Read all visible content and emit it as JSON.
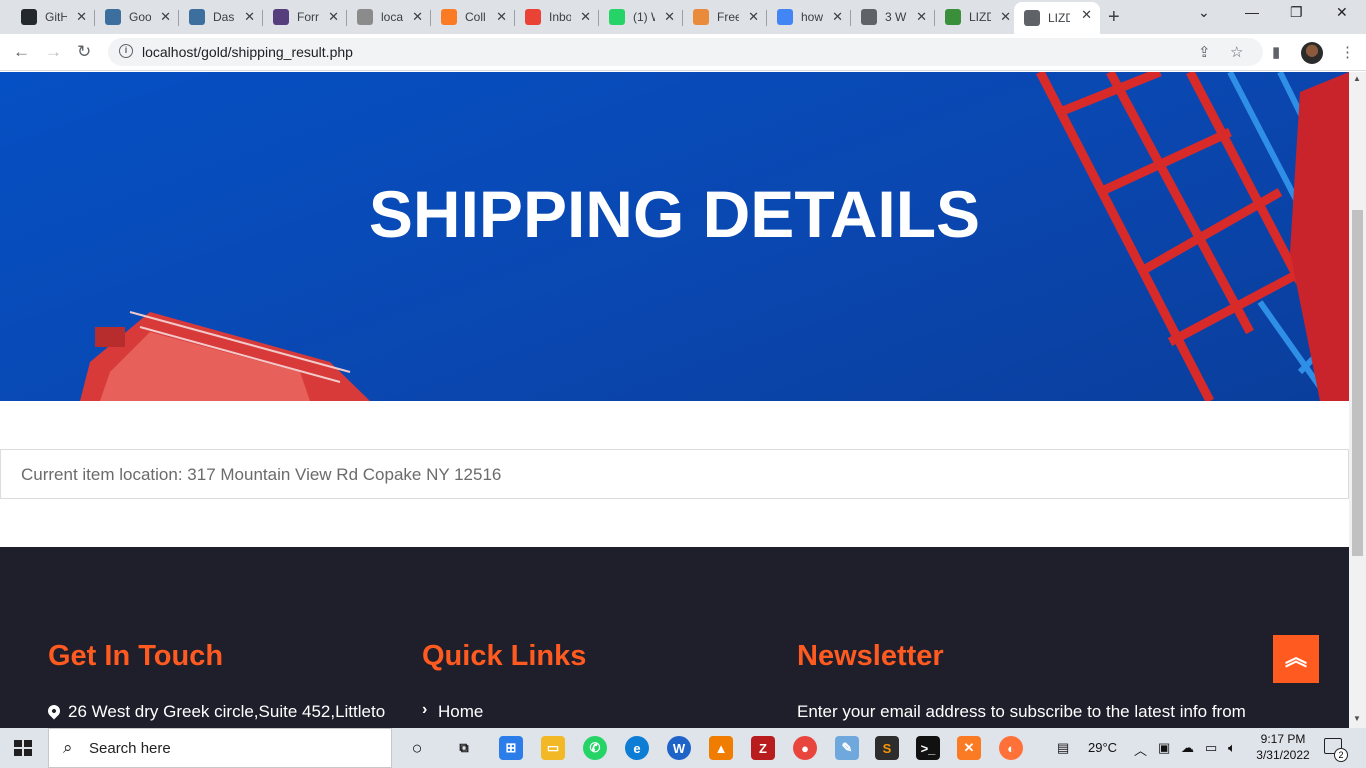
{
  "browser": {
    "tabs": [
      {
        "label": "GitH",
        "icon": "github-icon",
        "color": "#24292e"
      },
      {
        "label": "Goo",
        "icon": "google-play-icon",
        "color": "#3c6e9e"
      },
      {
        "label": "Das",
        "icon": "google-play-icon",
        "color": "#3c6e9e"
      },
      {
        "label": "Forr",
        "icon": "bootstrap-icon",
        "color": "#563d7c"
      },
      {
        "label": "loca",
        "icon": "sail-icon",
        "color": "#8b8b8b"
      },
      {
        "label": "Coll",
        "icon": "xampp-icon",
        "color": "#fb7a24"
      },
      {
        "label": "Inbo",
        "icon": "gmail-icon",
        "color": "#ea4335"
      },
      {
        "label": "(1) W",
        "icon": "whatsapp-icon",
        "color": "#25d366"
      },
      {
        "label": "Free",
        "icon": "box-icon",
        "color": "#e98b3a"
      },
      {
        "label": "how",
        "icon": "google-icon",
        "color": "#4285f4"
      },
      {
        "label": "3 W",
        "icon": "globe-icon",
        "color": "#5f6368"
      },
      {
        "label": "LIZD",
        "icon": "earth-icon",
        "color": "#3a8f3a"
      },
      {
        "label": "LIZD",
        "icon": "globe-icon",
        "color": "#5f6368",
        "active": true
      }
    ],
    "new_tab": "+",
    "url": "localhost/gold/shipping_result.php"
  },
  "page": {
    "hero_title": "SHIPPING DETAILS",
    "location_text": "Current item location: 317 Mountain View Rd Copake NY 12516",
    "footer": {
      "col1_heading": "Get In Touch",
      "col1_text": "26 West dry Greek circle,Suite 452,Littleto",
      "col2_heading": "Quick Links",
      "col2_link": "Home",
      "col3_heading": "Newsletter",
      "col3_text": "Enter your email address to subscribe to the latest info from"
    },
    "accent_color": "#ff5a1f"
  },
  "taskbar": {
    "search_placeholder": "Search here",
    "temperature": "29°C",
    "time": "9:17 PM",
    "date": "3/31/2022",
    "notifications": "2"
  }
}
